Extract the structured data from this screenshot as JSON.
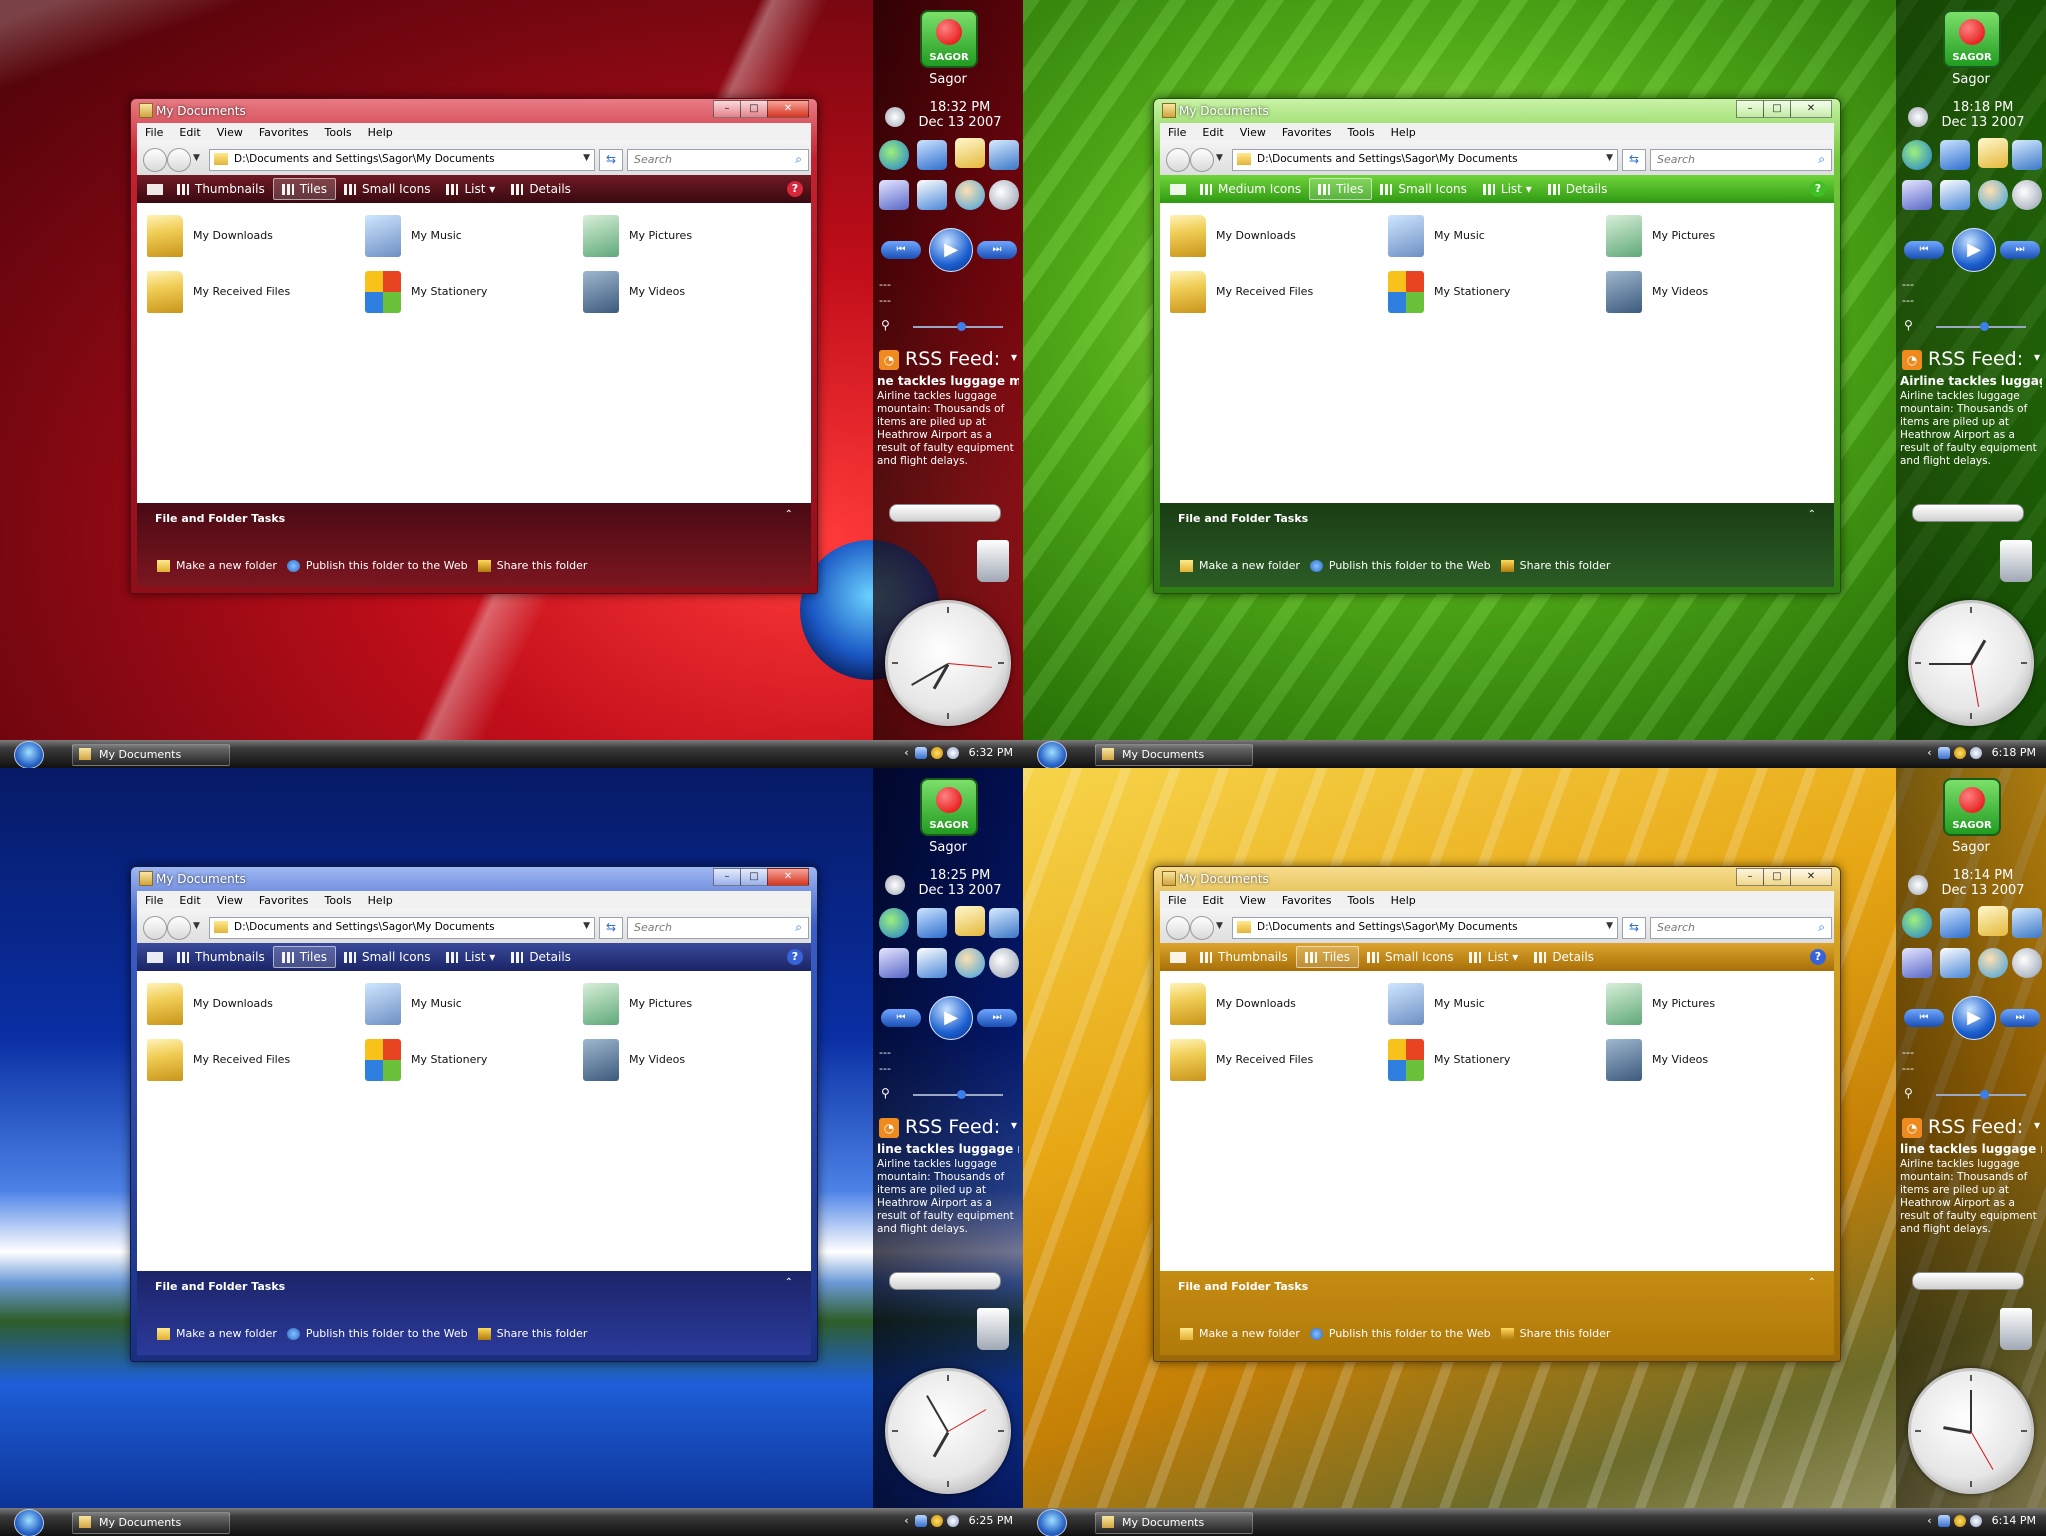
{
  "screens": [
    {
      "theme": "red",
      "window": {
        "title": "My Documents"
      },
      "sidebar": {
        "time": "18:32 PM",
        "date": "Dec 13 2007",
        "rss_headline": "ne tackles luggage mo"
      },
      "taskbar": {
        "clock": "6:32 PM"
      },
      "cmd_first": "Thumbnails"
    },
    {
      "theme": "green",
      "window": {
        "title": "My Documents"
      },
      "sidebar": {
        "time": "18:18 PM",
        "date": "Dec 13 2007",
        "rss_headline": "Airline tackles luggage"
      },
      "taskbar": {
        "clock": "6:18 PM"
      },
      "cmd_first": "Medium Icons"
    },
    {
      "theme": "blue",
      "window": {
        "title": "My Documents"
      },
      "sidebar": {
        "time": "18:25 PM",
        "date": "Dec 13 2007",
        "rss_headline": "line tackles luggage m"
      },
      "taskbar": {
        "clock": "6:25 PM"
      },
      "cmd_first": "Thumbnails"
    },
    {
      "theme": "gold",
      "window": {
        "title": "My Documents"
      },
      "sidebar": {
        "time": "18:14 PM",
        "date": "Dec 13 2007",
        "rss_headline": "line tackles luggage m"
      },
      "taskbar": {
        "clock": "6:14 PM"
      },
      "cmd_first": "Thumbnails"
    }
  ],
  "menu": [
    "File",
    "Edit",
    "View",
    "Favorites",
    "Tools",
    "Help"
  ],
  "address": "D:\\Documents and Settings\\Sagor\\My Documents",
  "search_placeholder": "Search",
  "cmd": {
    "tiles": "Tiles",
    "small_icons": "Small Icons",
    "list": "List",
    "details": "Details",
    "help": "?"
  },
  "files": [
    {
      "name": "My Downloads",
      "icon": "folder-icon"
    },
    {
      "name": "My Music",
      "icon": "music-folder-icon"
    },
    {
      "name": "My Pictures",
      "icon": "pictures-folder-icon"
    },
    {
      "name": "My Received Files",
      "icon": "folder-icon"
    },
    {
      "name": "My Stationery",
      "icon": "stationery-folder-icon"
    },
    {
      "name": "My Videos",
      "icon": "videos-folder-icon"
    }
  ],
  "tasks": {
    "title": "File and Folder Tasks",
    "new_folder": "Make a new folder",
    "publish": "Publish this folder to the Web",
    "share": "Share this folder"
  },
  "sidebar_common": {
    "logo": "SAGOR",
    "user": "Sagor",
    "track1": "---",
    "track2": "---",
    "rss_title": "RSS Feed:",
    "rss_summary": "Airline tackles luggage mountain: Thousands of items are piled up at Heathrow Airport as a result of faulty equipment and flight delays."
  },
  "taskbar_common": {
    "button": "My Documents"
  }
}
